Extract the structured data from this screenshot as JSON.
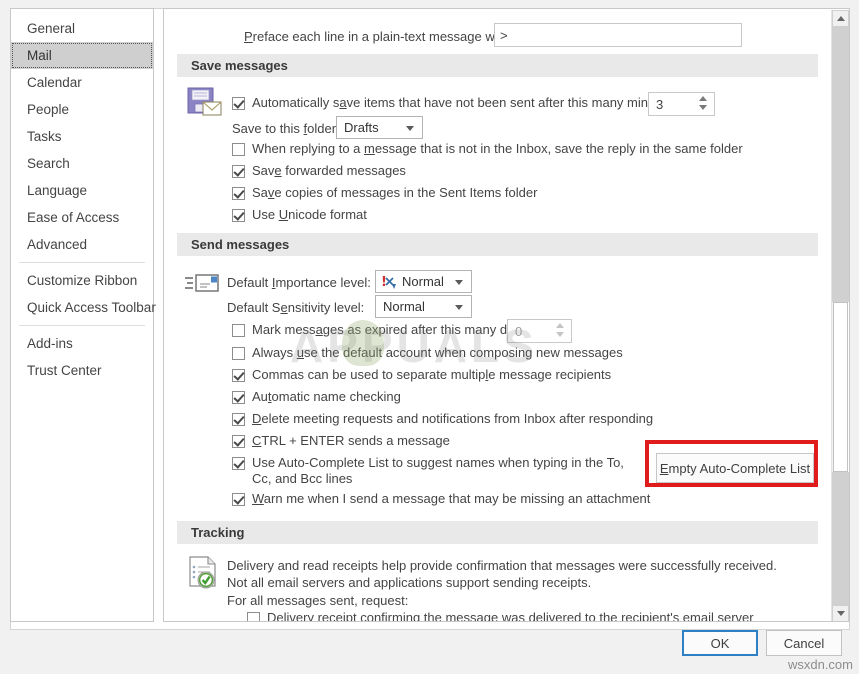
{
  "sidebar": {
    "items": [
      {
        "label": "General",
        "selected": false
      },
      {
        "label": "Mail",
        "selected": true
      },
      {
        "label": "Calendar",
        "selected": false
      },
      {
        "label": "People",
        "selected": false
      },
      {
        "label": "Tasks",
        "selected": false
      },
      {
        "label": "Search",
        "selected": false
      },
      {
        "label": "Language",
        "selected": false
      },
      {
        "label": "Ease of Access",
        "selected": false
      },
      {
        "label": "Advanced",
        "selected": false
      },
      {
        "label": "Customize Ribbon",
        "selected": false
      },
      {
        "label": "Quick Access Toolbar",
        "selected": false
      },
      {
        "label": "Add-ins",
        "selected": false
      },
      {
        "label": "Trust Center",
        "selected": false
      }
    ]
  },
  "preface": {
    "label_pre": "P",
    "label_rest": "reface each line in a plain-text message with:",
    "value": ">"
  },
  "save_messages": {
    "heading": "Save messages",
    "autosave": {
      "pre": "Automatically s",
      "accel": "a",
      "post": "ve items that have not been sent after this many minutes:",
      "checked": true,
      "minutes": "3"
    },
    "save_folder": {
      "pre": "Save to this ",
      "accel": "f",
      "post": "older:",
      "value": "Drafts"
    },
    "options": [
      {
        "pre": "When replying to a ",
        "accel": "m",
        "post": "essage that is not in the Inbox, save the reply in the same folder",
        "checked": false
      },
      {
        "pre": "Sav",
        "accel": "e",
        "post": " forwarded messages",
        "checked": true
      },
      {
        "pre": "Sa",
        "accel": "v",
        "post": "e copies of messages in the Sent Items folder",
        "checked": true
      },
      {
        "pre": "Use ",
        "accel": "U",
        "post": "nicode format",
        "checked": true
      }
    ]
  },
  "send_messages": {
    "heading": "Send messages",
    "importance": {
      "pre": "Default ",
      "accel": "I",
      "post": "mportance level:",
      "value": "Normal",
      "icon": "importance-normal-icon"
    },
    "sensitivity": {
      "pre": "Default S",
      "accel": "e",
      "post": "nsitivity level:",
      "value": "Normal"
    },
    "expire": {
      "pre": "Mark mess",
      "accel": "a",
      "post": "ges as expired after this many days:",
      "checked": false,
      "days": "0"
    },
    "options": [
      {
        "pre": "Always ",
        "accel": "u",
        "post": "se the default account when composing new messages",
        "checked": false
      },
      {
        "pre": "Commas can be used to separate multip",
        "accel": "l",
        "post": "e message recipients",
        "checked": true
      },
      {
        "pre": "Au",
        "accel": "t",
        "post": "omatic name checking",
        "checked": true
      },
      {
        "pre": "",
        "accel": "D",
        "post": "elete meeting requests and notifications from Inbox after responding",
        "checked": true
      },
      {
        "pre": "",
        "accel": "C",
        "post": "TRL + ENTER sends a message",
        "checked": true
      },
      {
        "pre": "Use Auto-Complete List to su",
        "accel": "g",
        "post": "gest names when typing in the To, Cc, and Bcc lines",
        "checked": true
      },
      {
        "pre": "",
        "accel": "W",
        "post": "arn me when I send a message that may be missing an attachment",
        "checked": true
      }
    ],
    "empty_autocomplete_button": {
      "pre": "",
      "accel": "E",
      "post": "mpty Auto-Complete List"
    }
  },
  "tracking": {
    "heading": "Tracking",
    "description": "Delivery and read receipts help provide confirmation that messages were successfully received. Not all email servers and applications support sending receipts.",
    "subheading": "For all messages sent, request:",
    "options": [
      {
        "pre": "Deliver",
        "accel": "y",
        "post": " receipt confirming the message was delivered to the recipient's email server",
        "checked": false
      }
    ]
  },
  "footer": {
    "ok": "OK",
    "cancel": "Cancel"
  },
  "overlay": {
    "watermark": "APPUALS",
    "credit": "wsxdn.com"
  },
  "colors": {
    "annotation_red": "#e01b1b",
    "focus_blue": "#2f7fc4",
    "selected_gray": "#cfcfcf",
    "group_header": "#e9e9e9"
  }
}
